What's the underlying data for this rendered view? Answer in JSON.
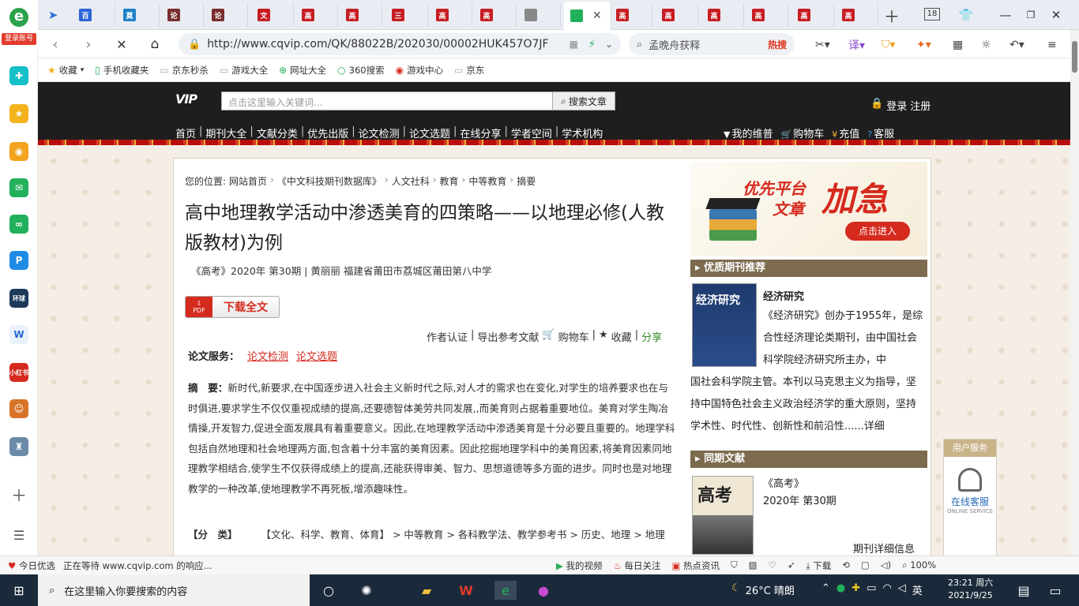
{
  "browser": {
    "login_label": "登录账号",
    "tabs": [
      {
        "label": "百",
        "color": "#2d64d8"
      },
      {
        "label": "莫",
        "color": "#1f80c8"
      },
      {
        "label": "论",
        "color": "#7a2e2e"
      },
      {
        "label": "论",
        "color": "#7a2e2e"
      },
      {
        "label": "文",
        "color": "#c61d23"
      },
      {
        "label": "高",
        "color": "#c61d23"
      },
      {
        "label": "高",
        "color": "#c61d23"
      },
      {
        "label": "三",
        "color": "#c61d23"
      },
      {
        "label": "高",
        "color": "#c61d23"
      },
      {
        "label": "高",
        "color": "#c61d23"
      },
      {
        "label": "",
        "color": "#888"
      },
      {
        "label": "",
        "color": "#23b05a"
      },
      {
        "label": "高",
        "color": "#c61d23"
      },
      {
        "label": "高",
        "color": "#c61d23"
      },
      {
        "label": "高",
        "color": "#c61d23"
      },
      {
        "label": "高",
        "color": "#c61d23"
      },
      {
        "label": "高",
        "color": "#c61d23"
      },
      {
        "label": "高",
        "color": "#c61d23"
      }
    ],
    "tab_count": "18",
    "url": "http://www.cqvip.com/QK/88022B/202030/00002HUK457O7JF",
    "search_text": "孟晚舟获释",
    "hot_label": "热搜",
    "bookmarks": [
      "收藏",
      "手机收藏夹",
      "京东秒杀",
      "游戏大全",
      "网址大全",
      "360搜索",
      "游戏中心",
      "京东"
    ]
  },
  "site": {
    "search_placeholder": "点击这里输入关键词...",
    "search_button": "搜索文章",
    "login": "登录",
    "register": "注册",
    "nav": [
      "首页",
      "期刊大全",
      "文献分类",
      "优先出版",
      "论文检测",
      "论文选题",
      "在线分享",
      "学者空间",
      "学术机构"
    ],
    "nav_right": [
      "我的维普",
      "购物车",
      "充值",
      "客服"
    ]
  },
  "article": {
    "crumb_prefix": "您的位置:",
    "crumbs": [
      "网站首页",
      "《中文科技期刊数据库》",
      "人文社科",
      "教育",
      "中等教育",
      "摘要"
    ],
    "title": "高中地理教学活动中渗透美育的四策略——以地理必修(人教版教材)为例",
    "meta": "《高考》2020年 第30期 | 黄丽丽   福建省莆田市荔城区莆田第八中学",
    "pdf_label": "PDF",
    "download_label": "下载全文",
    "actions": [
      "作者认证",
      "导出参考文献",
      "购物车",
      "收藏",
      "分享"
    ],
    "service_label": "论文服务：",
    "service_links": [
      "论文检测",
      "论文选题"
    ],
    "abstract_label": "摘　要：",
    "abstract": "新时代,新要求,在中国逐步进入社会主义新时代之际,对人才的需求也在变化,对学生的培养要求也在与时俱进,要求学生不仅仅重视成绩的提高,还要德智体美劳共同发展,,而美育则占据着重要地位。美育对学生陶冶情操,开发智力,促进全面发展具有着重要意义。因此,在地理教学活动中渗透美育是十分必要且重要的。地理学科包括自然地理和社会地理两方面,包含着十分丰富的美育因素。因此挖掘地理学科中的美育因素,将美育因素同地理教学相结合,使学生不仅获得成绩上的提高,还能获得审美、智力、思想道德等多方面的进步。同时也是对地理教学的一种改革,使地理教学不再死板,增添趣味性。",
    "class_label": "【分　类】",
    "class_text": "【文化、科学、教育、体育】 > 中等教育 > 各科教学法、教学参考书 > 历史、地理 > 地理"
  },
  "sidebar_right": {
    "ad_line1": "优先平台",
    "ad_line2": "文章",
    "ad_line3": "加急",
    "ad_button": "点击进入",
    "recommend_head": "优质期刊推荐",
    "journal_cover_text": "经济研究",
    "journal_name": "经济研究",
    "journal_desc_first": "《经济研究》创办于1955年，是综合性经济理论类期刊，由中国社会科学院经济研究所主办，中",
    "journal_desc_rest": "国社会科学院主管。本刊以马克思主义为指导，坚持中国特色社会主义政治经济学的重大原则，坚持学术性、时代性、创新性和前沿性......详细",
    "same_head": "同期文献",
    "same_cover_text": "高考",
    "same_journal": "《高考》",
    "same_issue": "2020年 第30期",
    "same_more": "期刊详细信息",
    "user_service_head": "用户服务",
    "online_service": "在线客服",
    "online_service_en": "ONLINE SERVICE"
  },
  "statusbar": {
    "left": [
      "今日优选",
      "正在等待 www.cqvip.com 的响应..."
    ],
    "right": [
      "我的视频",
      "每日关注",
      "热点资讯",
      "下载",
      "100%"
    ]
  },
  "taskbar": {
    "search_placeholder": "在这里输入你要搜索的内容",
    "weather": "26°C 晴朗",
    "ime": "英",
    "time": "23:21 周六",
    "date": "2021/9/25"
  }
}
